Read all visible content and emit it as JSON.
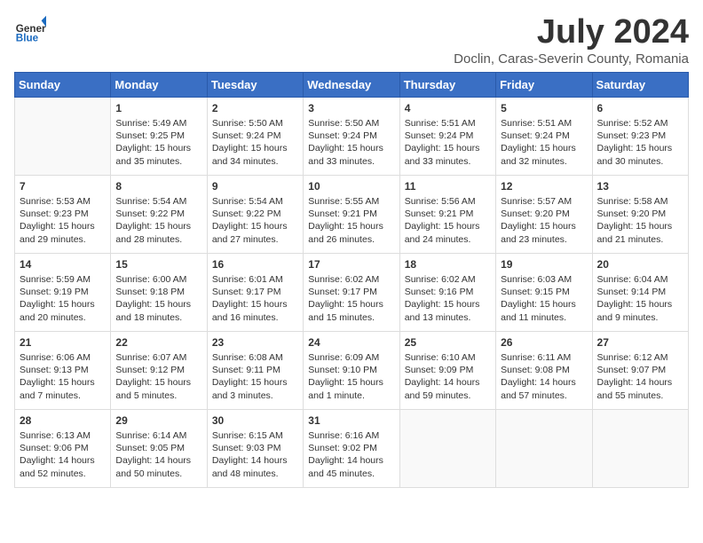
{
  "header": {
    "logo_general": "General",
    "logo_blue": "Blue",
    "title": "July 2024",
    "subtitle": "Doclin, Caras-Severin County, Romania"
  },
  "days_of_week": [
    "Sunday",
    "Monday",
    "Tuesday",
    "Wednesday",
    "Thursday",
    "Friday",
    "Saturday"
  ],
  "weeks": [
    [
      {
        "day": "",
        "empty": true
      },
      {
        "day": "1",
        "sunrise": "5:49 AM",
        "sunset": "9:25 PM",
        "daylight": "15 hours and 35 minutes."
      },
      {
        "day": "2",
        "sunrise": "5:50 AM",
        "sunset": "9:24 PM",
        "daylight": "15 hours and 34 minutes."
      },
      {
        "day": "3",
        "sunrise": "5:50 AM",
        "sunset": "9:24 PM",
        "daylight": "15 hours and 33 minutes."
      },
      {
        "day": "4",
        "sunrise": "5:51 AM",
        "sunset": "9:24 PM",
        "daylight": "15 hours and 33 minutes."
      },
      {
        "day": "5",
        "sunrise": "5:51 AM",
        "sunset": "9:24 PM",
        "daylight": "15 hours and 32 minutes."
      },
      {
        "day": "6",
        "sunrise": "5:52 AM",
        "sunset": "9:23 PM",
        "daylight": "15 hours and 30 minutes."
      }
    ],
    [
      {
        "day": "7",
        "sunrise": "5:53 AM",
        "sunset": "9:23 PM",
        "daylight": "15 hours and 29 minutes."
      },
      {
        "day": "8",
        "sunrise": "5:54 AM",
        "sunset": "9:22 PM",
        "daylight": "15 hours and 28 minutes."
      },
      {
        "day": "9",
        "sunrise": "5:54 AM",
        "sunset": "9:22 PM",
        "daylight": "15 hours and 27 minutes."
      },
      {
        "day": "10",
        "sunrise": "5:55 AM",
        "sunset": "9:21 PM",
        "daylight": "15 hours and 26 minutes."
      },
      {
        "day": "11",
        "sunrise": "5:56 AM",
        "sunset": "9:21 PM",
        "daylight": "15 hours and 24 minutes."
      },
      {
        "day": "12",
        "sunrise": "5:57 AM",
        "sunset": "9:20 PM",
        "daylight": "15 hours and 23 minutes."
      },
      {
        "day": "13",
        "sunrise": "5:58 AM",
        "sunset": "9:20 PM",
        "daylight": "15 hours and 21 minutes."
      }
    ],
    [
      {
        "day": "14",
        "sunrise": "5:59 AM",
        "sunset": "9:19 PM",
        "daylight": "15 hours and 20 minutes."
      },
      {
        "day": "15",
        "sunrise": "6:00 AM",
        "sunset": "9:18 PM",
        "daylight": "15 hours and 18 minutes."
      },
      {
        "day": "16",
        "sunrise": "6:01 AM",
        "sunset": "9:17 PM",
        "daylight": "15 hours and 16 minutes."
      },
      {
        "day": "17",
        "sunrise": "6:02 AM",
        "sunset": "9:17 PM",
        "daylight": "15 hours and 15 minutes."
      },
      {
        "day": "18",
        "sunrise": "6:02 AM",
        "sunset": "9:16 PM",
        "daylight": "15 hours and 13 minutes."
      },
      {
        "day": "19",
        "sunrise": "6:03 AM",
        "sunset": "9:15 PM",
        "daylight": "15 hours and 11 minutes."
      },
      {
        "day": "20",
        "sunrise": "6:04 AM",
        "sunset": "9:14 PM",
        "daylight": "15 hours and 9 minutes."
      }
    ],
    [
      {
        "day": "21",
        "sunrise": "6:06 AM",
        "sunset": "9:13 PM",
        "daylight": "15 hours and 7 minutes."
      },
      {
        "day": "22",
        "sunrise": "6:07 AM",
        "sunset": "9:12 PM",
        "daylight": "15 hours and 5 minutes."
      },
      {
        "day": "23",
        "sunrise": "6:08 AM",
        "sunset": "9:11 PM",
        "daylight": "15 hours and 3 minutes."
      },
      {
        "day": "24",
        "sunrise": "6:09 AM",
        "sunset": "9:10 PM",
        "daylight": "15 hours and 1 minute."
      },
      {
        "day": "25",
        "sunrise": "6:10 AM",
        "sunset": "9:09 PM",
        "daylight": "14 hours and 59 minutes."
      },
      {
        "day": "26",
        "sunrise": "6:11 AM",
        "sunset": "9:08 PM",
        "daylight": "14 hours and 57 minutes."
      },
      {
        "day": "27",
        "sunrise": "6:12 AM",
        "sunset": "9:07 PM",
        "daylight": "14 hours and 55 minutes."
      }
    ],
    [
      {
        "day": "28",
        "sunrise": "6:13 AM",
        "sunset": "9:06 PM",
        "daylight": "14 hours and 52 minutes."
      },
      {
        "day": "29",
        "sunrise": "6:14 AM",
        "sunset": "9:05 PM",
        "daylight": "14 hours and 50 minutes."
      },
      {
        "day": "30",
        "sunrise": "6:15 AM",
        "sunset": "9:03 PM",
        "daylight": "14 hours and 48 minutes."
      },
      {
        "day": "31",
        "sunrise": "6:16 AM",
        "sunset": "9:02 PM",
        "daylight": "14 hours and 45 minutes."
      },
      {
        "day": "",
        "empty": true
      },
      {
        "day": "",
        "empty": true
      },
      {
        "day": "",
        "empty": true
      }
    ]
  ]
}
